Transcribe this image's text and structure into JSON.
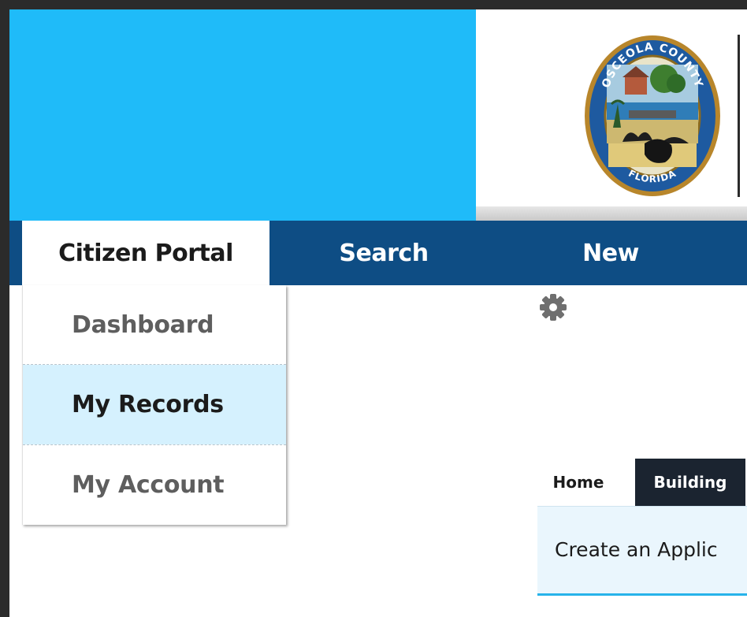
{
  "header": {
    "seal_text_top": "OSCEOLA COUNTY",
    "seal_text_bottom": "FLORIDA",
    "accent_color": "#1fbbf9"
  },
  "nav": {
    "items": [
      {
        "label": "Citizen Portal",
        "active": true
      },
      {
        "label": "Search",
        "active": false
      },
      {
        "label": "New",
        "active": false
      }
    ],
    "bar_color": "#0e4d84"
  },
  "dropdown": {
    "items": [
      {
        "label": "Dashboard",
        "selected": false
      },
      {
        "label": "My Records",
        "selected": true
      },
      {
        "label": "My Account",
        "selected": false
      }
    ]
  },
  "toolbar": {
    "settings_icon": "gear-icon"
  },
  "module_tabs": {
    "items": [
      {
        "label": "Home",
        "active": false
      },
      {
        "label": "Building",
        "active": true
      }
    ]
  },
  "panel": {
    "create_label": "Create an Applic"
  }
}
